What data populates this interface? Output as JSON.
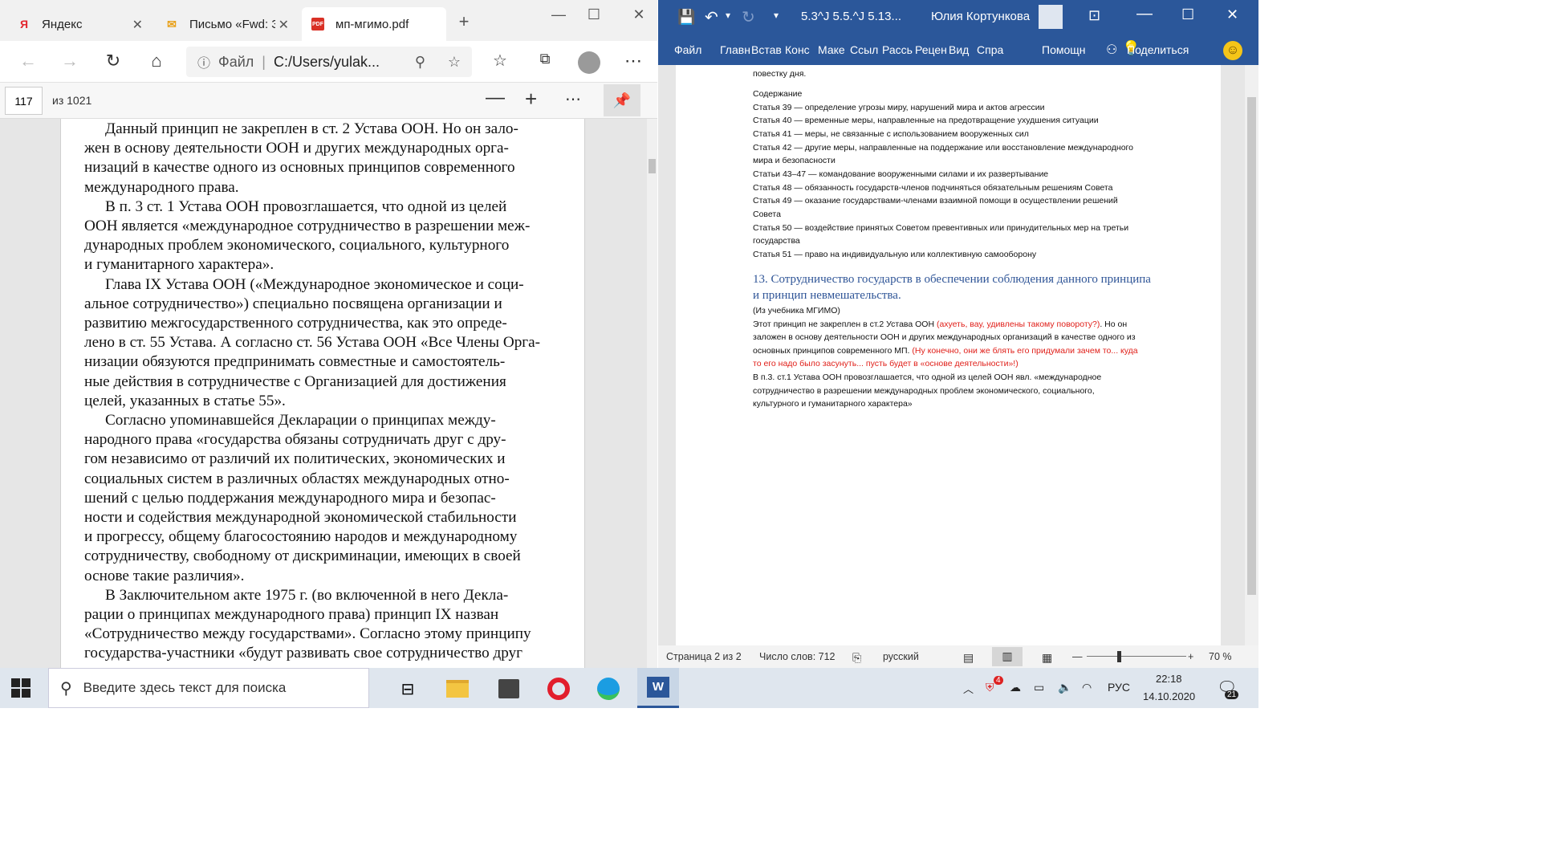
{
  "edge": {
    "tabs": [
      {
        "icon": "yandex-icon",
        "label": "Яндекс"
      },
      {
        "icon": "mail-icon",
        "label": "Письмо «Fwd: З"
      },
      {
        "icon": "pdf-icon",
        "label": "мп-мгимо.pdf"
      }
    ],
    "address": {
      "site_label": "Файл",
      "url": "C:/Users/yulak..."
    },
    "pdf_toolbar": {
      "page_number": "117",
      "page_total": "из 1021"
    },
    "pdf_lines": [
      "Данный принцип не закреплен в ст. 2 Устава ООН. Но он зало-",
      "жен в основу деятельности ООН и других международных орга-",
      "низаций в качестве одного из основных принципов современного",
      "международного права.",
      "В п. 3 ст. 1 Устава ООН провозглашается, что одной из целей",
      "ООН является «международное сотрудничество в разрешении меж-",
      "дународных проблем экономического, социального, культурного",
      "и гуманитарного характера».",
      "Глава IX Устава ООН («Международное экономическое и соци-",
      "альное сотрудничество») специально посвящена организации и",
      "развитию межгосударственного сотрудничества, как это опреде-",
      "лено в ст. 55 Устава. А согласно ст. 56 Устава ООН «Все Члены Орга-",
      "низации обязуются предпринимать совместные и самостоятель-",
      "ные действия в сотрудничестве с Организацией для достижения",
      "целей, указанных в статье 55».",
      "Согласно упоминавшейся Декларации о принципах между-",
      "народного права «государства обязаны сотрудничать друг с дру-",
      "гом независимо от различий их политических, экономических и",
      "социальных систем в различных областях международных отно-",
      "шений с целью поддержания международного мира и безопас-",
      "ности и содействия международной экономической стабильности",
      "и прогрессу, общему благосостоянию народов и международному",
      "сотрудничеству, свободному от дискриминации, имеющих в своей",
      "основе такие различия».",
      "В Заключительном акте 1975 г. (во включенной в него Декла-",
      "рации о принципах международного права) принцип IX назван",
      "«Сотрудничество между государствами». Согласно этому принципу",
      "государства-участники «будут развивать свое сотрудничество друг"
    ]
  },
  "word": {
    "doc_title": "5.3^J 5.5.^J 5.13...",
    "user_name": "Юлия Кортункова",
    "ribbon_tabs": [
      "Файл",
      "Главн",
      "Встав",
      "Конс",
      "Маке",
      "Ссыл",
      "Рассь",
      "Рецен",
      "Вид",
      "Спра"
    ],
    "help_label": "Помощн",
    "share_label": "Поделиться",
    "lines": [
      {
        "text": "повестку дня.",
        "style": "normal"
      },
      {
        "text": "Содержание",
        "style": "normal"
      },
      {
        "text": "Статья 39 — определение угрозы миру, нарушений мира и актов агрессии",
        "style": "normal"
      },
      {
        "text": "Статья 40 — временные меры, направленные на предотвращение ухудшения ситуации",
        "style": "normal"
      },
      {
        "text": "Статья 41 — меры, не связанные с использованием вооруженных сил",
        "style": "normal"
      },
      {
        "text": "Статья 42 — другие меры, направленные на поддержание или восстановление международного",
        "style": "normal"
      },
      {
        "text": "мира и безопасности",
        "style": "normal"
      },
      {
        "text": "Статьи 43–47 — командование вооруженными силами и их развертывание",
        "style": "normal"
      },
      {
        "text": "Статья 48 — обязанность государств-членов подчиняться обязательным решениям Совета",
        "style": "normal"
      },
      {
        "text": "Статья 49 — оказание государствами-членами взаимной помощи в осуществлении решений",
        "style": "normal"
      },
      {
        "text": "Совета",
        "style": "normal"
      },
      {
        "text": "Статья 50 — воздействие принятых Советом превентивных или принудительных мер на третьи",
        "style": "normal"
      },
      {
        "text": "государства",
        "style": "normal"
      },
      {
        "text": "Статья 51 — право на индивидуальную или коллективную самооборону",
        "style": "normal"
      }
    ],
    "heading": [
      "13. Сотрудничество государств в обеспечении соблюдения данного принципа",
      "и принцип невмешательства."
    ],
    "body": [
      [
        {
          "t": "(Из учебника МГИМО)",
          "red": false
        }
      ],
      [
        {
          "t": "Этот принцип не закреплен в ст.2 Устава ООН ",
          "red": false
        },
        {
          "t": "(ахуеть, вау, удивлены такому повороту?)",
          "red": true
        },
        {
          "t": ". Но он",
          "red": false
        }
      ],
      [
        {
          "t": "заложен в основу деятельности ООН и других международных организаций в качестве одного из",
          "red": false
        }
      ],
      [
        {
          "t": "основных принципов современного МП. ",
          "red": false
        },
        {
          "t": "(Ну конечно, они же блять его придумали зачем то... куда",
          "red": true
        }
      ],
      [
        {
          "t": "то его надо было засунуть... пусть будет в «основе деятельности»!)",
          "red": true
        }
      ],
      [
        {
          "t": "В п.3. ст.1 Устава ООН провозглашается, что одной из целей ООН явл. «международное",
          "red": false
        }
      ],
      [
        {
          "t": "сотрудничество в разрешении международных проблем экономического, социального,",
          "red": false
        }
      ],
      [
        {
          "t": "культурного и гуманитарного характера»",
          "red": false
        }
      ]
    ],
    "status": {
      "page": "Страница 2 из 2",
      "words": "Число слов: 712",
      "language": "русский",
      "zoom": "70 %"
    }
  },
  "taskbar": {
    "search_placeholder": "Введите здесь текст для поиска",
    "lang": "РУС",
    "time": "22:18",
    "date": "14.10.2020",
    "notif_count": "21",
    "badge_count": "4"
  },
  "colors": {
    "word_blue": "#2b579a",
    "heading_blue": "#2f5597",
    "comment_red": "#e0201a"
  }
}
